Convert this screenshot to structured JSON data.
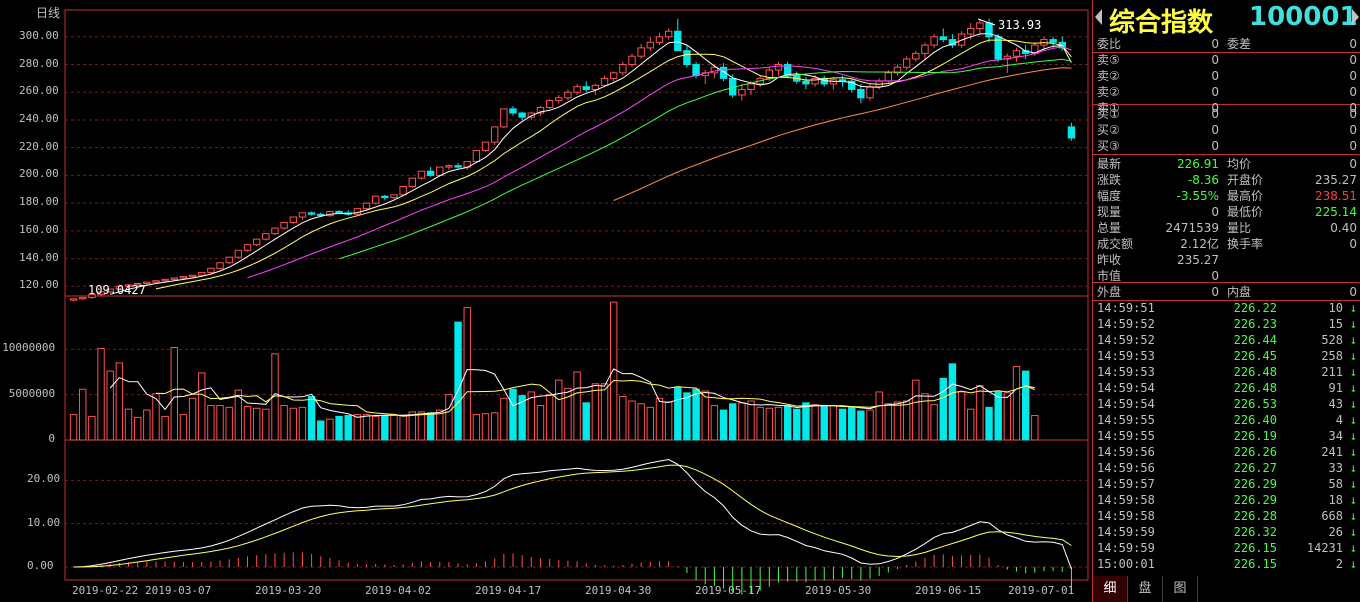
{
  "chart_panel": {
    "period_label": "日线",
    "price_axis": [
      "300.00",
      "280.00",
      "260.00",
      "240.00",
      "220.00",
      "200.00",
      "180.00",
      "160.00",
      "140.00",
      "120.00"
    ],
    "volume_axis": [
      "10000000",
      "5000000",
      "0"
    ],
    "macd_axis": [
      "20.00",
      "10.00",
      "0.00"
    ],
    "date_axis": [
      "2019-02-22",
      "2019-03-07",
      "2019-03-20",
      "2019-04-02",
      "2019-04-17",
      "2019-04-30",
      "2019-05-17",
      "2019-05-30",
      "2019-06-15",
      "2019-07-01"
    ],
    "high_marker": "313.93",
    "low_marker": "109.0427"
  },
  "chart_data": {
    "type": "candlestick",
    "y_range": [
      113,
      315
    ],
    "volume_range": [
      0,
      15000000
    ],
    "macd_range": [
      -3,
      27
    ],
    "candles": [
      [
        110,
        111,
        109,
        111
      ],
      [
        111,
        112,
        110,
        112
      ],
      [
        112,
        114,
        111,
        114
      ],
      [
        114,
        116,
        113,
        116
      ],
      [
        116,
        118,
        115,
        118
      ],
      [
        118,
        120,
        117,
        120
      ],
      [
        120,
        121,
        119,
        121
      ],
      [
        121,
        122,
        120,
        122
      ],
      [
        122,
        123,
        121,
        123
      ],
      [
        123,
        124,
        122,
        124
      ],
      [
        124,
        125,
        123,
        125
      ],
      [
        125,
        126,
        124,
        126
      ],
      [
        126,
        127,
        125,
        127
      ],
      [
        127,
        128,
        126,
        128
      ],
      [
        128,
        130,
        127,
        130
      ],
      [
        130,
        133,
        129,
        133
      ],
      [
        133,
        137,
        132,
        137
      ],
      [
        137,
        141,
        136,
        141
      ],
      [
        141,
        146,
        140,
        146
      ],
      [
        146,
        150,
        145,
        150
      ],
      [
        150,
        154,
        149,
        154
      ],
      [
        154,
        158,
        153,
        158
      ],
      [
        158,
        162,
        157,
        162
      ],
      [
        162,
        166,
        161,
        166
      ],
      [
        166,
        170,
        165,
        170
      ],
      [
        170,
        173,
        168,
        173
      ],
      [
        173,
        174,
        171,
        172
      ],
      [
        172,
        173,
        170,
        171
      ],
      [
        171,
        174,
        170,
        174
      ],
      [
        174,
        175,
        172,
        173
      ],
      [
        173,
        175,
        171,
        172
      ],
      [
        172,
        176,
        171,
        176
      ],
      [
        176,
        180,
        175,
        180
      ],
      [
        180,
        185,
        179,
        185
      ],
      [
        185,
        186,
        182,
        184
      ],
      [
        184,
        186,
        183,
        186
      ],
      [
        186,
        192,
        185,
        192
      ],
      [
        192,
        198,
        191,
        198
      ],
      [
        198,
        203,
        197,
        203
      ],
      [
        203,
        206,
        199,
        200
      ],
      [
        200,
        206,
        199,
        206
      ],
      [
        206,
        208,
        204,
        207
      ],
      [
        207,
        209,
        205,
        206
      ],
      [
        206,
        210,
        204,
        210
      ],
      [
        210,
        218,
        209,
        218
      ],
      [
        218,
        224,
        217,
        224
      ],
      [
        224,
        235,
        222,
        235
      ],
      [
        235,
        248,
        234,
        248
      ],
      [
        248,
        250,
        243,
        245
      ],
      [
        245,
        246,
        240,
        242
      ],
      [
        242,
        246,
        240,
        245
      ],
      [
        245,
        250,
        243,
        249
      ],
      [
        249,
        255,
        248,
        254
      ],
      [
        254,
        258,
        252,
        256
      ],
      [
        256,
        262,
        254,
        260
      ],
      [
        260,
        266,
        258,
        264
      ],
      [
        264,
        268,
        260,
        262
      ],
      [
        262,
        266,
        258,
        265
      ],
      [
        265,
        272,
        264,
        270
      ],
      [
        270,
        275,
        268,
        274
      ],
      [
        274,
        282,
        272,
        280
      ],
      [
        280,
        288,
        278,
        286
      ],
      [
        286,
        295,
        284,
        292
      ],
      [
        292,
        300,
        290,
        296
      ],
      [
        296,
        303,
        294,
        300
      ],
      [
        300,
        306,
        298,
        304
      ],
      [
        304,
        313,
        300,
        290
      ],
      [
        290,
        294,
        278,
        280
      ],
      [
        280,
        282,
        270,
        272
      ],
      [
        272,
        276,
        266,
        274
      ],
      [
        274,
        280,
        270,
        278
      ],
      [
        278,
        281,
        268,
        270
      ],
      [
        270,
        273,
        256,
        258
      ],
      [
        258,
        266,
        254,
        262
      ],
      [
        262,
        268,
        258,
        266
      ],
      [
        266,
        272,
        264,
        270
      ],
      [
        270,
        278,
        268,
        276
      ],
      [
        276,
        282,
        272,
        280
      ],
      [
        280,
        282,
        270,
        272
      ],
      [
        272,
        275,
        266,
        268
      ],
      [
        268,
        271,
        262,
        266
      ],
      [
        266,
        272,
        264,
        270
      ],
      [
        270,
        272,
        264,
        266
      ],
      [
        266,
        271,
        262,
        269
      ],
      [
        269,
        272,
        264,
        268
      ],
      [
        268,
        270,
        260,
        262
      ],
      [
        262,
        266,
        252,
        256
      ],
      [
        256,
        266,
        254,
        264
      ],
      [
        264,
        270,
        262,
        268
      ],
      [
        268,
        276,
        266,
        274
      ],
      [
        274,
        280,
        272,
        278
      ],
      [
        278,
        286,
        276,
        284
      ],
      [
        284,
        290,
        282,
        288
      ],
      [
        288,
        296,
        284,
        294
      ],
      [
        294,
        302,
        292,
        300
      ],
      [
        300,
        306,
        296,
        298
      ],
      [
        298,
        302,
        292,
        294
      ],
      [
        294,
        304,
        292,
        302
      ],
      [
        302,
        310,
        298,
        306
      ],
      [
        306,
        313,
        302,
        310
      ],
      [
        310,
        313,
        296,
        300
      ],
      [
        300,
        302,
        282,
        284
      ],
      [
        284,
        288,
        274,
        286
      ],
      [
        286,
        292,
        282,
        290
      ],
      [
        290,
        294,
        284,
        288
      ],
      [
        288,
        296,
        286,
        294
      ],
      [
        294,
        300,
        290,
        298
      ],
      [
        298,
        300,
        292,
        296
      ],
      [
        296,
        300,
        290,
        292
      ],
      [
        235,
        238,
        225,
        227
      ]
    ],
    "volumes": [
      2800000,
      5600000,
      2600000,
      10100000,
      7600000,
      8500000,
      3400000,
      2500000,
      3300000,
      5100000,
      2600000,
      10200000,
      2800000,
      4600000,
      7400000,
      3800000,
      3800000,
      3600000,
      5500000,
      3700000,
      3500000,
      3400000,
      9500000,
      3800000,
      3500000,
      3600000,
      4800000,
      2100000,
      2300000,
      2600000,
      2700000,
      2800000,
      2800000,
      2600000,
      2700000,
      2800000,
      2700000,
      3100000,
      3100000,
      3000000,
      3300000,
      5000000,
      13000000,
      14600000,
      2800000,
      2900000,
      3000000,
      4600000,
      5600000,
      4900000,
      5300000,
      3800000,
      5000000,
      6600000,
      5700000,
      7500000,
      4100000,
      6200000,
      6200000,
      15200000,
      4800000,
      4300000,
      4000000,
      3600000,
      4600000,
      4200000,
      5800000,
      5200000,
      5600000,
      5400000,
      3800000,
      3300000,
      4000000,
      4100000,
      4300000,
      3600000,
      3500000,
      3600000,
      3800000,
      3400000,
      4100000,
      3900000,
      3700000,
      3800000,
      3400000,
      3600000,
      3200000,
      3300000,
      5300000,
      4000000,
      4200000,
      4300000,
      6600000,
      5100000,
      3900000,
      6800000,
      8400000,
      5300000,
      3400000,
      6000000,
      3600000,
      5300000,
      5200000,
      8100000,
      7600000,
      2700000
    ],
    "macd_dif": [],
    "macd_dea": []
  },
  "sidebar": {
    "title": "综合指数",
    "code": "100001",
    "rows": [
      {
        "l": "委比",
        "v1": "0",
        "l2": "委差",
        "v2": "0"
      },
      {
        "l": "卖⑤",
        "v1": "0",
        "l2": "",
        "v2": "0"
      },
      {
        "l": "卖②",
        "v1": "0",
        "l2": "",
        "v2": "0"
      },
      {
        "l": "卖②",
        "v1": "0",
        "l2": "",
        "v2": "0"
      },
      {
        "l": "卖①",
        "v1": "0",
        "l2": "",
        "v2": "0"
      },
      {
        "l": "买①",
        "v1": "0",
        "l2": "",
        "v2": "0"
      },
      {
        "l": "买②",
        "v1": "0",
        "l2": "",
        "v2": "0"
      },
      {
        "l": "买③",
        "v1": "0",
        "l2": "",
        "v2": "0"
      },
      {
        "l": "最新",
        "v1": "226.91",
        "l2": "均价",
        "v2": "0"
      },
      {
        "l": "涨跌",
        "v1": "-8.36",
        "l2": "开盘价",
        "v2": "235.27"
      },
      {
        "l": "幅度",
        "v1": "-3.55%",
        "l2": "最高价",
        "v2": "238.51"
      },
      {
        "l": "现量",
        "v1": "0",
        "l2": "最低价",
        "v2": "225.14"
      },
      {
        "l": "总量",
        "v1": "2471539",
        "l2": "量比",
        "v2": "0.40"
      },
      {
        "l": "成交额",
        "v1": "2.12亿",
        "l2": "换手率",
        "v2": "0"
      },
      {
        "l": "昨收",
        "v1": "235.27",
        "l2": "",
        "v2": ""
      },
      {
        "l": "市值",
        "v1": "0",
        "l2": "",
        "v2": ""
      },
      {
        "l": "外盘",
        "v1": "0",
        "l2": "内盘",
        "v2": "0"
      }
    ],
    "colors": {
      "v1_green": "#40ff40",
      "v2_red": "#ff4040",
      "v2_green": "#40ff40"
    },
    "ticks": [
      {
        "time": "14:59:51",
        "price": "226.22",
        "vol": "10",
        "arrow": "↓"
      },
      {
        "time": "14:59:52",
        "price": "226.23",
        "vol": "15",
        "arrow": "↓"
      },
      {
        "time": "14:59:52",
        "price": "226.44",
        "vol": "528",
        "arrow": "↓"
      },
      {
        "time": "14:59:53",
        "price": "226.45",
        "vol": "258",
        "arrow": "↓"
      },
      {
        "time": "14:59:53",
        "price": "226.48",
        "vol": "211",
        "arrow": "↓"
      },
      {
        "time": "14:59:54",
        "price": "226.48",
        "vol": "91",
        "arrow": "↓"
      },
      {
        "time": "14:59:54",
        "price": "226.53",
        "vol": "43",
        "arrow": "↓"
      },
      {
        "time": "14:59:55",
        "price": "226.40",
        "vol": "4",
        "arrow": "↓"
      },
      {
        "time": "14:59:55",
        "price": "226.19",
        "vol": "34",
        "arrow": "↓"
      },
      {
        "time": "14:59:56",
        "price": "226.26",
        "vol": "241",
        "arrow": "↓"
      },
      {
        "time": "14:59:56",
        "price": "226.27",
        "vol": "33",
        "arrow": "↓"
      },
      {
        "time": "14:59:57",
        "price": "226.29",
        "vol": "58",
        "arrow": "↓"
      },
      {
        "time": "14:59:58",
        "price": "226.29",
        "vol": "18",
        "arrow": "↓"
      },
      {
        "time": "14:59:58",
        "price": "226.28",
        "vol": "668",
        "arrow": "↓"
      },
      {
        "time": "14:59:59",
        "price": "226.32",
        "vol": "26",
        "arrow": "↓"
      },
      {
        "time": "14:59:59",
        "price": "226.15",
        "vol": "14231",
        "arrow": "↓"
      },
      {
        "time": "15:00:01",
        "price": "226.15",
        "vol": "2",
        "arrow": "↓"
      }
    ],
    "tabs": [
      "细",
      "盘",
      "图"
    ]
  }
}
